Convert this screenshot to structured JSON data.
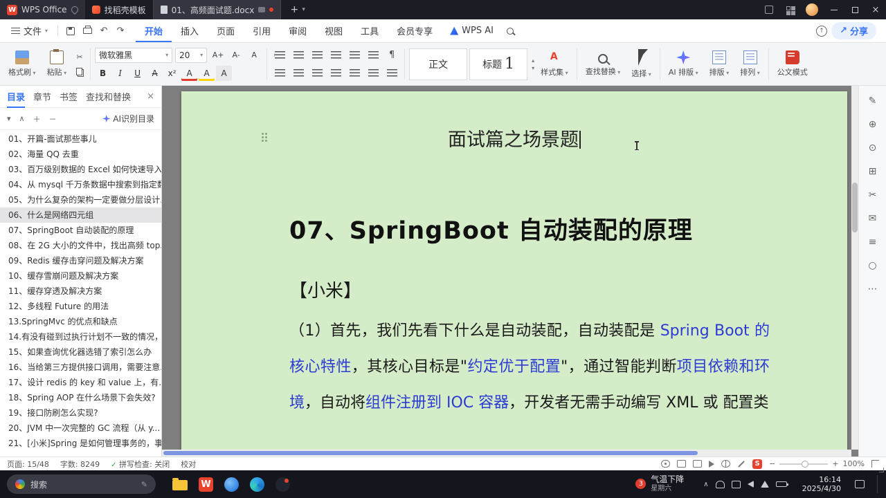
{
  "titlebar": {
    "logo_letter": "W",
    "app_tab": "WPS Office",
    "template_tab": "找稻壳模板",
    "doc_tab": "01、高频面试题.docx"
  },
  "menubar": {
    "file_label": "文件",
    "tabs": [
      "开始",
      "插入",
      "页面",
      "引用",
      "审阅",
      "视图",
      "工具",
      "会员专享"
    ],
    "active_tab_index": 0,
    "wps_ai_label": "WPS AI",
    "share_label": "分享"
  },
  "ribbon": {
    "format_painter": "格式刷",
    "paste": "粘贴",
    "font_name": "微软雅黑",
    "font_size": "20",
    "font_tools": [
      "A+",
      "A-",
      "A"
    ],
    "format_buttons": [
      "B",
      "I",
      "U",
      "A",
      "x²",
      "A",
      "A",
      "A"
    ],
    "styles": [
      {
        "label": "正文",
        "big": ""
      },
      {
        "label": "标题",
        "big": "1"
      }
    ],
    "style_set": "样式集",
    "find_replace": "查找替换",
    "select": "选择",
    "ai_layout": "AI 排版",
    "layout": "排版",
    "arrange": "排列",
    "doc_mode": "公文模式"
  },
  "sidebar": {
    "tabs": [
      "目录",
      "章节",
      "书签",
      "查找和替换"
    ],
    "active_tab_index": 0,
    "ai_recognize": "AI识别目录",
    "items": [
      {
        "label": "01、开篇-面试那些事儿",
        "selected": false
      },
      {
        "label": "02、海量 QQ 去重",
        "selected": false
      },
      {
        "label": "03、百万级别数据的 Excel 如何快速导入...",
        "selected": false
      },
      {
        "label": "04、从 mysql 千万条数据中搜索到指定数...",
        "selected": false
      },
      {
        "label": "05、为什么复杂的架构一定要做分层设计...",
        "selected": false
      },
      {
        "label": "06、什么是网络四元组",
        "selected": true
      },
      {
        "label": "07、SpringBoot 自动装配的原理",
        "selected": false
      },
      {
        "label": "08、在 2G 大小的文件中，找出高频 top...",
        "selected": false
      },
      {
        "label": "09、Redis 缓存击穿问题及解决方案",
        "selected": false
      },
      {
        "label": "10、缓存雪崩问题及解决方案",
        "selected": false
      },
      {
        "label": "11、缓存穿透及解决方案",
        "selected": false
      },
      {
        "label": "12、多线程 Future 的用法",
        "selected": false
      },
      {
        "label": "13.SpringMvc 的优点和缺点",
        "selected": false
      },
      {
        "label": "14.有没有碰到过执行计划不一致的情况，...",
        "selected": false
      },
      {
        "label": "15、如果查询优化器选错了索引怎么办",
        "selected": false
      },
      {
        "label": "16、当给第三方提供接口调用，需要注意...",
        "selected": false
      },
      {
        "label": "17、设计 redis 的 key 和 value 上，有...",
        "selected": false
      },
      {
        "label": "18、Spring AOP 在什么场景下会失效?",
        "selected": false
      },
      {
        "label": "19、接口防刷怎么实现?",
        "selected": false
      },
      {
        "label": "20、JVM 中一次完整的 GC 流程（从 y...",
        "selected": false
      },
      {
        "label": "21、[小米]Spring 是如何管理事务的，事...",
        "selected": false
      }
    ]
  },
  "document": {
    "title": "面试篇之场景题",
    "heading": "07、SpringBoot 自动装配的原理",
    "tag": "【小米】",
    "paragraph": [
      {
        "text": "（1）首先，我们先看下什么是自动装配，自动装配是 ",
        "link": false
      },
      {
        "text": "Spring Boot 的核心特性",
        "link": true
      },
      {
        "text": "，其核心目标是\"",
        "link": false
      },
      {
        "text": "约定优于配置",
        "link": true
      },
      {
        "text": "\"，通过智能判断",
        "link": false
      },
      {
        "text": "项目依赖和环境",
        "link": true
      },
      {
        "text": "，自动将",
        "link": false
      },
      {
        "text": "组件注册到 IOC 容器",
        "link": true
      },
      {
        "text": "，开发者无需手动编写 XML 或 ",
        "link": false
      },
      {
        "text": "配置类",
        "link": false
      }
    ]
  },
  "statusbar": {
    "page": "页面: 15/48",
    "words": "字数: 8249",
    "spellcheck": "拼写检查: 关闭",
    "proofread": "校对",
    "wps_badge": "S",
    "zoom": "100%"
  },
  "taskbar": {
    "search_placeholder": "搜索",
    "wps_letter": "W",
    "weather_badge": "3",
    "weather_title": "气温下降",
    "weather_sub": "星期六",
    "time": "16:14",
    "date": "2025/4/30"
  }
}
